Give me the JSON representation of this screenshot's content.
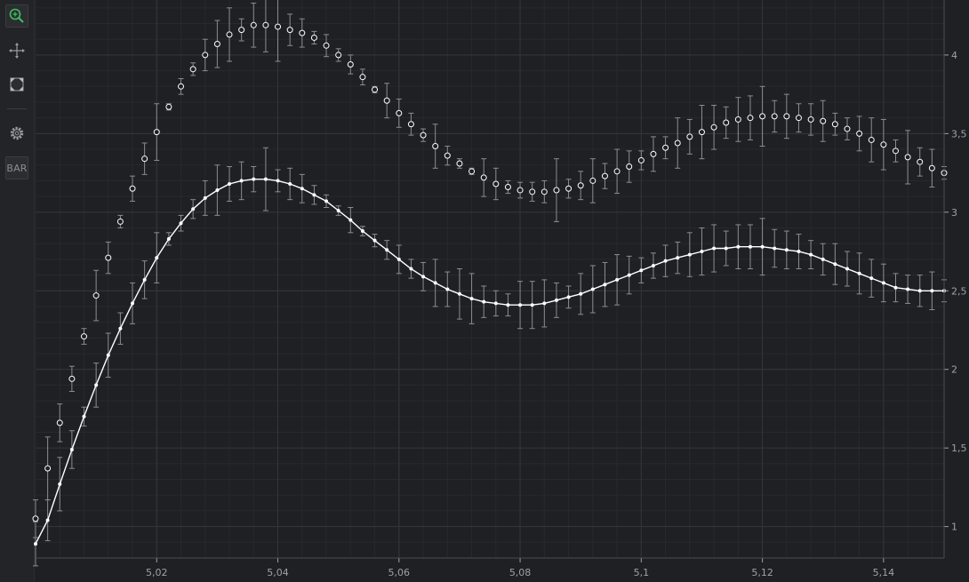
{
  "toolbar": {
    "items": [
      {
        "name": "zoom-icon",
        "color": "#3fbf5f"
      },
      {
        "name": "pan-icon"
      },
      {
        "name": "zoom-extents-icon"
      },
      {
        "name": "settings-icon"
      },
      {
        "name": "bar-toggle",
        "label": "BAR"
      }
    ]
  },
  "colors": {
    "background": "#1f2023",
    "grid_major": "#34363b",
    "grid_minor": "#27292d",
    "series_line": "#ffffff",
    "error_bar": "#8a8d91",
    "tick_text": "#9ea1a6"
  },
  "chart_data": {
    "type": "scatter",
    "title": "",
    "xlabel": "",
    "ylabel": "",
    "xlim": [
      5.0,
      5.15
    ],
    "ylim": [
      0.8,
      4.35
    ],
    "x_ticks": [
      5.02,
      5.04,
      5.06,
      5.08,
      5.1,
      5.12,
      5.14
    ],
    "x_tick_labels": [
      "5,02",
      "5,04",
      "5,06",
      "5,08",
      "5,1",
      "5,12",
      "5,14"
    ],
    "y_ticks": [
      1,
      1.5,
      2,
      2.5,
      3,
      3.5,
      4
    ],
    "y_tick_labels": [
      "1",
      "1,5",
      "2",
      "2,5",
      "3",
      "3,5",
      "4"
    ],
    "grid": true,
    "y_axis_position": "right",
    "series": [
      {
        "style": "open-circle markers with error bars",
        "x": [
          5.0,
          5.002,
          5.004,
          5.006,
          5.008,
          5.01,
          5.012,
          5.014,
          5.016,
          5.018,
          5.02,
          5.022,
          5.024,
          5.026,
          5.028,
          5.03,
          5.032,
          5.034,
          5.036,
          5.038,
          5.04,
          5.042,
          5.044,
          5.046,
          5.048,
          5.05,
          5.052,
          5.054,
          5.056,
          5.058,
          5.06,
          5.062,
          5.064,
          5.066,
          5.068,
          5.07,
          5.072,
          5.074,
          5.076,
          5.078,
          5.08,
          5.082,
          5.084,
          5.086,
          5.088,
          5.09,
          5.092,
          5.094,
          5.096,
          5.098,
          5.1,
          5.102,
          5.104,
          5.106,
          5.108,
          5.11,
          5.112,
          5.114,
          5.116,
          5.118,
          5.12,
          5.122,
          5.124,
          5.126,
          5.128,
          5.13,
          5.132,
          5.134,
          5.136,
          5.138,
          5.14,
          5.142,
          5.144,
          5.146,
          5.148,
          5.15
        ],
        "y": [
          1.05,
          1.37,
          1.66,
          1.94,
          2.21,
          2.47,
          2.71,
          2.94,
          3.15,
          3.34,
          3.51,
          3.67,
          3.8,
          3.91,
          4.0,
          4.07,
          4.13,
          4.16,
          4.19,
          4.19,
          4.18,
          4.16,
          4.14,
          4.11,
          4.06,
          4.0,
          3.94,
          3.86,
          3.78,
          3.71,
          3.63,
          3.56,
          3.49,
          3.42,
          3.36,
          3.31,
          3.26,
          3.22,
          3.18,
          3.16,
          3.14,
          3.13,
          3.13,
          3.14,
          3.15,
          3.17,
          3.2,
          3.23,
          3.26,
          3.29,
          3.33,
          3.37,
          3.41,
          3.44,
          3.48,
          3.51,
          3.54,
          3.57,
          3.59,
          3.6,
          3.61,
          3.61,
          3.61,
          3.6,
          3.59,
          3.58,
          3.56,
          3.53,
          3.5,
          3.46,
          3.43,
          3.39,
          3.35,
          3.32,
          3.28,
          3.25
        ],
        "error": [
          0.12,
          0.2,
          0.12,
          0.08,
          0.05,
          0.16,
          0.1,
          0.04,
          0.08,
          0.1,
          0.18,
          0.02,
          0.05,
          0.04,
          0.1,
          0.15,
          0.17,
          0.07,
          0.14,
          0.17,
          0.22,
          0.1,
          0.09,
          0.04,
          0.07,
          0.04,
          0.06,
          0.05,
          0.02,
          0.11,
          0.09,
          0.07,
          0.04,
          0.14,
          0.06,
          0.03,
          0.02,
          0.12,
          0.1,
          0.04,
          0.05,
          0.06,
          0.07,
          0.2,
          0.06,
          0.09,
          0.14,
          0.08,
          0.14,
          0.1,
          0.06,
          0.11,
          0.07,
          0.16,
          0.11,
          0.17,
          0.14,
          0.1,
          0.14,
          0.14,
          0.19,
          0.1,
          0.14,
          0.09,
          0.1,
          0.13,
          0.07,
          0.07,
          0.11,
          0.14,
          0.16,
          0.07,
          0.17,
          0.09,
          0.12,
          0.04
        ]
      },
      {
        "style": "line with filled markers and error bars",
        "x": [
          5.0,
          5.002,
          5.004,
          5.006,
          5.008,
          5.01,
          5.012,
          5.014,
          5.016,
          5.018,
          5.02,
          5.022,
          5.024,
          5.026,
          5.028,
          5.03,
          5.032,
          5.034,
          5.036,
          5.038,
          5.04,
          5.042,
          5.044,
          5.046,
          5.048,
          5.05,
          5.052,
          5.054,
          5.056,
          5.058,
          5.06,
          5.062,
          5.064,
          5.066,
          5.068,
          5.07,
          5.072,
          5.074,
          5.076,
          5.078,
          5.08,
          5.082,
          5.084,
          5.086,
          5.088,
          5.09,
          5.092,
          5.094,
          5.096,
          5.098,
          5.1,
          5.102,
          5.104,
          5.106,
          5.108,
          5.11,
          5.112,
          5.114,
          5.116,
          5.118,
          5.12,
          5.122,
          5.124,
          5.126,
          5.128,
          5.13,
          5.132,
          5.134,
          5.136,
          5.138,
          5.14,
          5.142,
          5.144,
          5.146,
          5.148,
          5.15
        ],
        "y": [
          0.89,
          1.04,
          1.27,
          1.49,
          1.7,
          1.9,
          2.09,
          2.26,
          2.42,
          2.57,
          2.71,
          2.83,
          2.93,
          3.02,
          3.09,
          3.14,
          3.18,
          3.2,
          3.21,
          3.21,
          3.2,
          3.18,
          3.15,
          3.11,
          3.07,
          3.01,
          2.95,
          2.88,
          2.82,
          2.76,
          2.7,
          2.64,
          2.59,
          2.55,
          2.51,
          2.48,
          2.45,
          2.43,
          2.42,
          2.41,
          2.41,
          2.41,
          2.42,
          2.44,
          2.46,
          2.48,
          2.51,
          2.54,
          2.57,
          2.6,
          2.63,
          2.66,
          2.69,
          2.71,
          2.73,
          2.75,
          2.77,
          2.77,
          2.78,
          2.78,
          2.78,
          2.77,
          2.76,
          2.75,
          2.73,
          2.7,
          2.67,
          2.64,
          2.61,
          2.58,
          2.55,
          2.52,
          2.51,
          2.5,
          2.5,
          2.5
        ],
        "error": [
          0.14,
          0.13,
          0.17,
          0.12,
          0.06,
          0.14,
          0.14,
          0.1,
          0.13,
          0.12,
          0.16,
          0.04,
          0.05,
          0.06,
          0.11,
          0.16,
          0.11,
          0.12,
          0.08,
          0.2,
          0.07,
          0.1,
          0.09,
          0.06,
          0.04,
          0.03,
          0.08,
          0.03,
          0.04,
          0.06,
          0.09,
          0.06,
          0.09,
          0.15,
          0.11,
          0.16,
          0.16,
          0.1,
          0.08,
          0.07,
          0.15,
          0.15,
          0.15,
          0.11,
          0.07,
          0.13,
          0.15,
          0.14,
          0.16,
          0.12,
          0.08,
          0.08,
          0.1,
          0.1,
          0.14,
          0.15,
          0.15,
          0.11,
          0.14,
          0.14,
          0.18,
          0.12,
          0.12,
          0.11,
          0.09,
          0.1,
          0.13,
          0.11,
          0.13,
          0.12,
          0.12,
          0.09,
          0.09,
          0.1,
          0.12,
          0.07
        ]
      }
    ]
  }
}
